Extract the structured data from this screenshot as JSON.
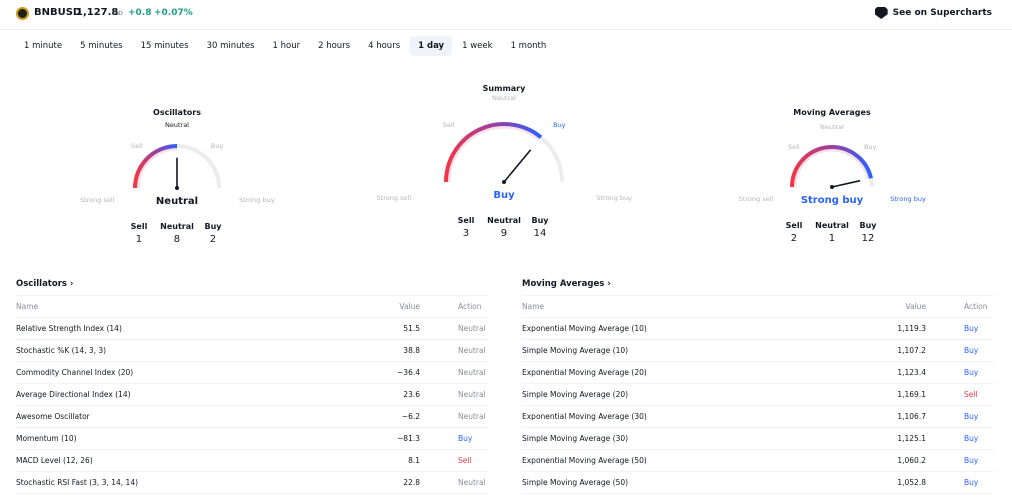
{
  "header": {
    "symbol": "BNBUSD",
    "price": "1,127.8",
    "currency": "USD",
    "change": "+0.8",
    "change_pct": "+0.07%",
    "supercharts_label": "See on Supercharts"
  },
  "tabs": [
    {
      "label": "1 minute"
    },
    {
      "label": "5 minutes"
    },
    {
      "label": "15 minutes"
    },
    {
      "label": "30 minutes"
    },
    {
      "label": "1 hour"
    },
    {
      "label": "2 hours"
    },
    {
      "label": "4 hours"
    },
    {
      "label": "1 day",
      "active": true
    },
    {
      "label": "1 week"
    },
    {
      "label": "1 month"
    }
  ],
  "colors": {
    "sell": "#f23645",
    "buy": "#2962ff",
    "neutral": "#8a8d96",
    "accent": "#1f9c8a"
  },
  "gauges": {
    "oscillators": {
      "title": "Oscillators",
      "labels": {
        "strong_sell": "Strong sell",
        "sell": "Sell",
        "neutral": "Neutral",
        "buy": "Buy",
        "strong_buy": "Strong buy"
      },
      "result": "Neutral",
      "needle": 0.5,
      "counts": {
        "sell_label": "Sell",
        "sell": "1",
        "neutral_label": "Neutral",
        "neutral": "8",
        "buy_label": "Buy",
        "buy": "2"
      }
    },
    "summary": {
      "title": "Summary",
      "labels": {
        "strong_sell": "Strong sell",
        "sell": "Sell",
        "neutral": "Neutral",
        "buy": "Buy",
        "strong_buy": "Strong buy"
      },
      "result": "Buy",
      "needle": 0.72,
      "counts": {
        "sell_label": "Sell",
        "sell": "3",
        "neutral_label": "Neutral",
        "neutral": "9",
        "buy_label": "Buy",
        "buy": "14"
      }
    },
    "moving_averages": {
      "title": "Moving Averages",
      "labels": {
        "strong_sell": "Strong sell",
        "sell": "Sell",
        "neutral": "Neutral",
        "buy": "Buy",
        "strong_buy": "Strong buy"
      },
      "result": "Strong buy",
      "needle": 0.93,
      "counts": {
        "sell_label": "Sell",
        "sell": "2",
        "neutral_label": "Neutral",
        "neutral": "1",
        "buy_label": "Buy",
        "buy": "12"
      }
    }
  },
  "oscillators_table": {
    "title": "Oscillators ›",
    "columns": [
      "Name",
      "Value",
      "Action"
    ],
    "rows": [
      [
        "Relative Strength Index (14)",
        "51.5",
        "Neutral"
      ],
      [
        "Stochastic %K (14, 3, 3)",
        "38.8",
        "Neutral"
      ],
      [
        "Commodity Channel Index (20)",
        "−36.4",
        "Neutral"
      ],
      [
        "Average Directional Index (14)",
        "23.6",
        "Neutral"
      ],
      [
        "Awesome Oscillator",
        "−6.2",
        "Neutral"
      ],
      [
        "Momentum (10)",
        "−81.3",
        "Buy"
      ],
      [
        "MACD Level (12, 26)",
        "8.1",
        "Sell"
      ],
      [
        "Stochastic RSI Fast (3, 3, 14, 14)",
        "22.8",
        "Neutral"
      ]
    ]
  },
  "ma_table": {
    "title": "Moving Averages ›",
    "columns": [
      "Name",
      "Value",
      "Action"
    ],
    "rows": [
      [
        "Exponential Moving Average (10)",
        "1,119.3",
        "Buy"
      ],
      [
        "Simple Moving Average (10)",
        "1,107.2",
        "Buy"
      ],
      [
        "Exponential Moving Average (20)",
        "1,123.4",
        "Buy"
      ],
      [
        "Simple Moving Average (20)",
        "1,169.1",
        "Sell"
      ],
      [
        "Exponential Moving Average (30)",
        "1,106.7",
        "Buy"
      ],
      [
        "Simple Moving Average (30)",
        "1,125.1",
        "Buy"
      ],
      [
        "Exponential Moving Average (50)",
        "1,060.2",
        "Buy"
      ],
      [
        "Simple Moving Average (50)",
        "1,052.8",
        "Buy"
      ]
    ]
  }
}
